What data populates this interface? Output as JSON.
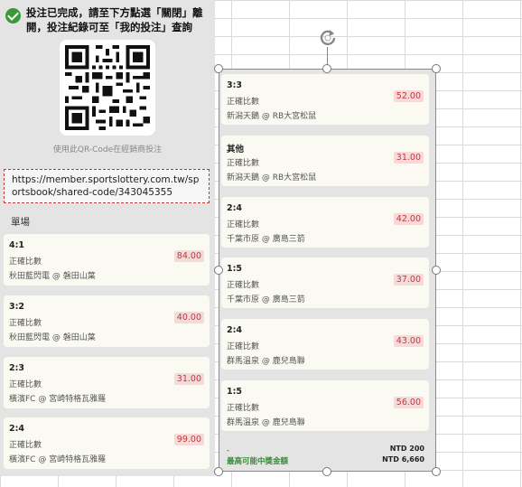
{
  "notice": {
    "text": "投注已完成，請至下方點選「關閉」離開，投注紀錄可至「我的投注」查詢"
  },
  "qr": {
    "caption": "使用此QR-Code在經銷商投注"
  },
  "share_url": "https://member.sportslottery.com.tw/sportsbook/shared-code/343045355",
  "section_label": "單場",
  "left_bets": [
    {
      "score": "4:1",
      "market": "正確比數",
      "match": "秋田藍閃電 @ 磐田山葉",
      "odds": "84.00"
    },
    {
      "score": "3:2",
      "market": "正確比數",
      "match": "秋田藍閃電 @ 磐田山葉",
      "odds": "40.00"
    },
    {
      "score": "2:3",
      "market": "正確比數",
      "match": "橫濱FC @ 宮崎特格瓦雅羅",
      "odds": "31.00"
    },
    {
      "score": "2:4",
      "market": "正確比數",
      "match": "橫濱FC @ 宮崎特格瓦雅羅",
      "odds": "99.00"
    }
  ],
  "right_bets": [
    {
      "score": "3:3",
      "market": "正確比數",
      "match": "新潟天鵝 @ RB大宮松鼠",
      "odds": "52.00"
    },
    {
      "score": "其他",
      "market": "正確比數",
      "match": "新潟天鵝 @ RB大宮松鼠",
      "odds": "31.00"
    },
    {
      "score": "2:4",
      "market": "正確比數",
      "match": "千葉市原 @ 廣島三箭",
      "odds": "42.00"
    },
    {
      "score": "1:5",
      "market": "正確比數",
      "match": "千葉市原 @ 廣島三箭",
      "odds": "37.00"
    },
    {
      "score": "2:4",
      "market": "正確比數",
      "match": "群馬溫泉 @ 鹿兒島聯",
      "odds": "43.00"
    },
    {
      "score": "1:5",
      "market": "正確比數",
      "match": "群馬溫泉 @ 鹿兒島聯",
      "odds": "56.00"
    }
  ],
  "summary": {
    "dash": "-",
    "stake": "NTD 200",
    "max_label": "最高可能中獎金額",
    "max_value": "NTD 6,660"
  },
  "colors": {
    "panel_bg": "#e4e4e4",
    "card_bg": "#fbfaf2",
    "odds_text": "#c0393b",
    "odds_bg": "#f6dada",
    "success_green": "#3a9a3a"
  }
}
